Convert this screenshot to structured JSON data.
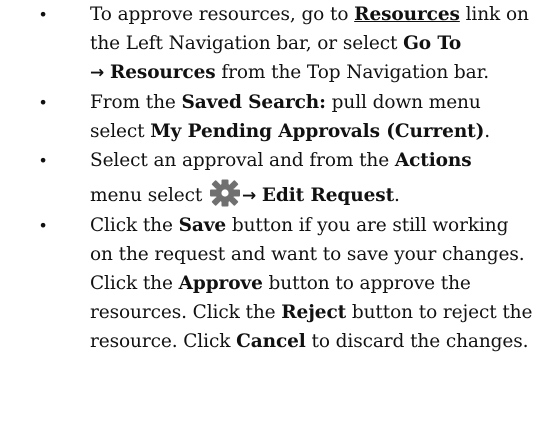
{
  "bullet_glyph": "•",
  "arrow_glyph": "→",
  "items": [
    {
      "t1": "To approve resources, go to ",
      "resources_link": "Resources",
      "t2": " link on the Left Navigation bar, or select ",
      "go_to": "Go To",
      "resources_menu": "Resources",
      "t3": " from the Top Navigation bar."
    },
    {
      "t1": "From the ",
      "saved_search": "Saved Search:",
      "t2": " pull down menu select ",
      "pending": "My Pending Approvals (Current)",
      "t3": "."
    },
    {
      "t1": "Select an approval and from the ",
      "actions": "Actions",
      "t2": "menu select ",
      "gear_icon": "gear-icon",
      "edit_request": "Edit Request",
      "t3": "."
    },
    {
      "t1": "Click the ",
      "save": "Save",
      "t2": " button if you are still working on the request and want to save your changes. Click the ",
      "approve": "Approve",
      "t3": " button to approve the resources. Click the ",
      "reject": "Reject",
      "t4": " button to reject the resource. Click ",
      "cancel": "Cancel",
      "t5": " to discard the changes."
    }
  ],
  "colors": {
    "text": "#111111",
    "gear": "#707070"
  }
}
